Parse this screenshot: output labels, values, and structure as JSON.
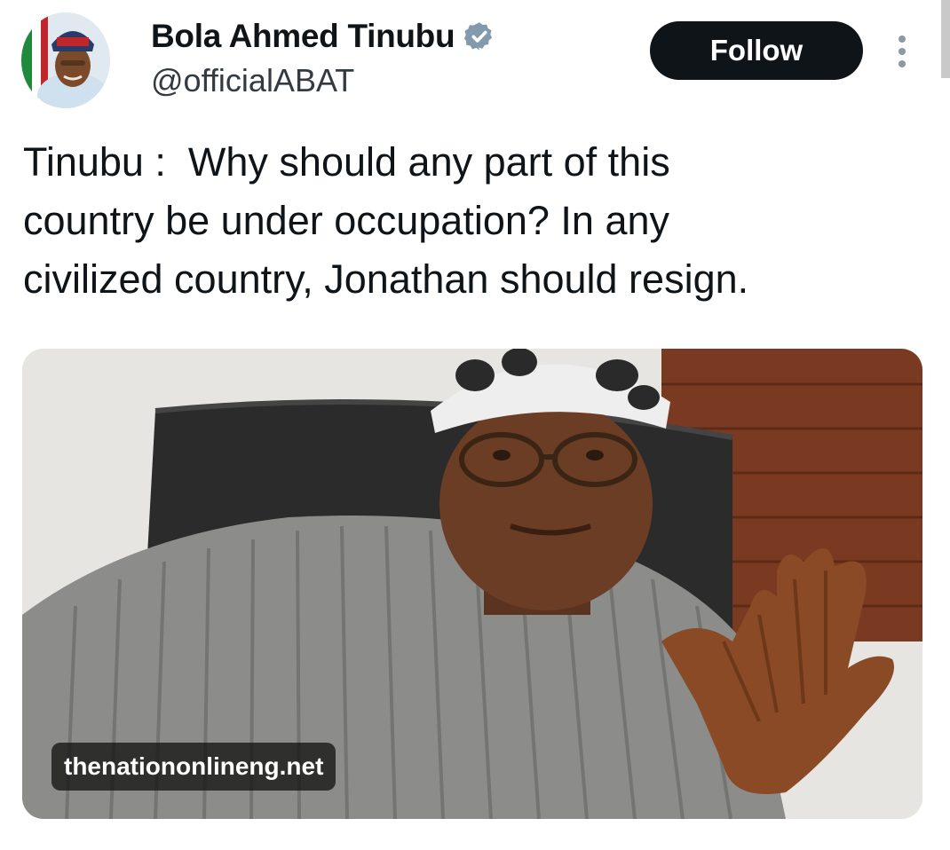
{
  "author": {
    "name": "Bola Ahmed Tinubu",
    "handle": "@officialABAT",
    "verified_icon": "verified-badge-icon",
    "avatar_icon": "profile-avatar"
  },
  "actions": {
    "follow_label": "Follow",
    "more_icon": "more-vertical-icon"
  },
  "tweet": {
    "text": "Tinubu :  Why should any part of this\ncountry be under occupation? In any\ncivilized country, Jonathan should resign."
  },
  "media": {
    "source_label": "thenationonlineng.net"
  },
  "colors": {
    "text": "#0f1419",
    "handle": "#333a41",
    "follow_bg": "#0f1419",
    "follow_text": "#ffffff",
    "verified": "#829aab"
  }
}
